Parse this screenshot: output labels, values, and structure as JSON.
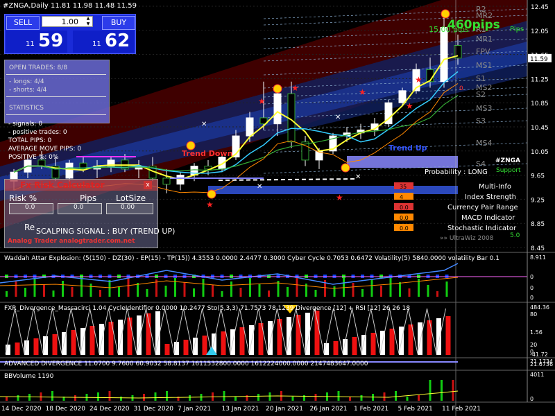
{
  "chart_header": {
    "symbol_line": "#ZNGA,Daily  11.81 11.98 11.48 11.59"
  },
  "trade_panel": {
    "sell_label": "SELL",
    "buy_label": "BUY",
    "lot_value": "1.00",
    "bid_small": "11",
    "bid_big": "59",
    "ask_small": "11",
    "ask_big": "62"
  },
  "stats_panel": {
    "open_trades": "OPEN TRADES: 8/8",
    "longs": "- longs: 4/4",
    "shorts": "- shorts: 4/4",
    "statistics": "STATISTICS",
    "signals": "- signals: 0",
    "positive_trades": "- positive trades: 0",
    "total_pips": "TOTAL PIPS: 0",
    "average_move": "AVERAGE MOVE PIPS: 0",
    "positive_pct": "POSITIVE %: 0%"
  },
  "risk_calc": {
    "title": "Fx Risk Calculator",
    "close": "x",
    "risk_label": "Risk %",
    "pips_label": "Pips",
    "lot_label": "LotSize",
    "risk_value": "0.0",
    "pips_value": "0.0",
    "lot_value": "0.00",
    "re_label": "Re",
    "website": "Analog Trader analogtrader.com.net"
  },
  "overlay_text": {
    "scalping": "SCALPING  SIGNAL :  BUY  (TREND  UP)",
    "pips_big": "460pips",
    "pips_small": "15.00 pips",
    "pips_suffix": "Pips",
    "trend_up": "Trend Up",
    "trend_down": "Trend Down",
    "symbol_tag": "#ZNGA",
    "probability": "Probability : LONG",
    "support": "Support",
    "multi_info": "Multi-Info",
    "index_strength": "Index Strength",
    "currency_pair_range": "Currency Pair Range",
    "macd": "MACD Indicator",
    "stochastic": "Stochastic Indicator",
    "ultra": "»»  UltraWiz 2008",
    "legend_values": [
      "35",
      "4",
      "0.0",
      "0.0",
      "0.0"
    ],
    "value_num": "0",
    "rating": "5.0"
  },
  "levels": [
    "R2",
    "MR2",
    "R1",
    "MR1",
    "FPV",
    "MS1",
    "S1",
    "MS2",
    "S2",
    "MS3",
    "S3",
    "MS4",
    "S4"
  ],
  "price_axis": {
    "ticks": [
      "12.45",
      "12.05",
      "11.65",
      "11.25",
      "10.85",
      "10.45",
      "10.05",
      "9.65",
      "9.25",
      "8.85",
      "8.45"
    ],
    "current": "11.59"
  },
  "panels": {
    "waddah": {
      "label": "Waddah Attar Explosion: (5(150) - DZ(30) - EP(15) - TP(15)) 4.3553 0.0000 2.4477 0.3000  Cyber Cycle 0.7053 0.6472  Volatility(5) 5840.0000  volatility  Bar 0.1",
      "ticks": [
        "8.911",
        "0",
        "0",
        "0"
      ]
    },
    "fxr": {
      "label": "FXR_Divergence_Massacirci  1.04  CycleIdentifior 0.0000 10.2477  Sto(5,3,3) 71.7573 78.1239  Divergence [12] + RSI [12] 26 26 18",
      "ticks": [
        "484.36",
        "80",
        "20",
        "1.56",
        "0",
        "-41.72"
      ]
    },
    "adv": {
      "label": "ADVANCED DIVERGENCE 11.0700 9.7600 60.9032 58.8137 1611532800.0000 1612224000.0000 2147483647.0000",
      "ticks": [
        "71.1734",
        "21.6736"
      ]
    },
    "bbv": {
      "label": "BBVolume 1190",
      "ticks": [
        "4011",
        "0"
      ]
    }
  },
  "time_axis": [
    "14 Dec 2020",
    "18 Dec 2020",
    "24 Dec 2020",
    "31 Dec 2020",
    "7 Jan 2021",
    "13 Jan 2021",
    "20 Jan 2021",
    "26 Jan 2021",
    "1 Feb 2021",
    "5 Feb 2021",
    "11 Feb 2021"
  ],
  "chart_data": {
    "type": "line",
    "title": "#ZNGA,Daily",
    "price_range": [
      8.45,
      12.5
    ],
    "current_price": 11.59,
    "candles": [
      {
        "o": 9.55,
        "h": 9.75,
        "l": 9.4,
        "c": 9.7
      },
      {
        "o": 9.7,
        "h": 10.0,
        "l": 9.6,
        "c": 9.9
      },
      {
        "o": 9.9,
        "h": 10.05,
        "l": 9.75,
        "c": 9.8
      },
      {
        "o": 9.8,
        "h": 9.95,
        "l": 9.55,
        "c": 9.6
      },
      {
        "o": 9.6,
        "h": 9.9,
        "l": 9.5,
        "c": 9.85
      },
      {
        "o": 9.85,
        "h": 9.95,
        "l": 9.7,
        "c": 9.75
      },
      {
        "o": 9.75,
        "h": 9.9,
        "l": 9.6,
        "c": 9.8
      },
      {
        "o": 9.8,
        "h": 9.95,
        "l": 9.7,
        "c": 9.9
      },
      {
        "o": 9.9,
        "h": 10.0,
        "l": 9.7,
        "c": 9.75
      },
      {
        "o": 9.75,
        "h": 9.9,
        "l": 9.6,
        "c": 9.8
      },
      {
        "o": 9.8,
        "h": 9.95,
        "l": 9.55,
        "c": 9.6
      },
      {
        "o": 9.6,
        "h": 9.75,
        "l": 9.35,
        "c": 9.5
      },
      {
        "o": 9.5,
        "h": 9.7,
        "l": 9.4,
        "c": 9.65
      },
      {
        "o": 9.65,
        "h": 9.85,
        "l": 9.55,
        "c": 9.8
      },
      {
        "o": 9.8,
        "h": 9.9,
        "l": 9.65,
        "c": 9.75
      },
      {
        "o": 9.75,
        "h": 10.0,
        "l": 9.7,
        "c": 9.95
      },
      {
        "o": 9.95,
        "h": 10.4,
        "l": 9.9,
        "c": 10.3
      },
      {
        "o": 10.3,
        "h": 10.7,
        "l": 10.2,
        "c": 10.6
      },
      {
        "o": 10.6,
        "h": 11.2,
        "l": 10.4,
        "c": 10.5
      },
      {
        "o": 10.5,
        "h": 11.1,
        "l": 10.3,
        "c": 11.0
      },
      {
        "o": 11.0,
        "h": 11.2,
        "l": 10.1,
        "c": 10.2
      },
      {
        "o": 10.2,
        "h": 10.3,
        "l": 9.8,
        "c": 9.9
      },
      {
        "o": 9.9,
        "h": 10.1,
        "l": 9.75,
        "c": 10.05
      },
      {
        "o": 10.05,
        "h": 10.35,
        "l": 10.0,
        "c": 10.3
      },
      {
        "o": 10.3,
        "h": 10.45,
        "l": 10.2,
        "c": 10.35
      },
      {
        "o": 10.35,
        "h": 10.5,
        "l": 10.25,
        "c": 10.4
      },
      {
        "o": 10.4,
        "h": 10.6,
        "l": 10.3,
        "c": 10.5
      },
      {
        "o": 10.5,
        "h": 10.9,
        "l": 10.45,
        "c": 10.85
      },
      {
        "o": 10.85,
        "h": 11.1,
        "l": 10.8,
        "c": 11.05
      },
      {
        "o": 11.05,
        "h": 11.5,
        "l": 11.0,
        "c": 11.4
      },
      {
        "o": 11.4,
        "h": 11.6,
        "l": 11.1,
        "c": 11.2
      },
      {
        "o": 11.2,
        "h": 12.3,
        "l": 11.1,
        "c": 12.1
      },
      {
        "o": 11.8,
        "h": 11.98,
        "l": 11.48,
        "c": 11.59
      }
    ]
  }
}
